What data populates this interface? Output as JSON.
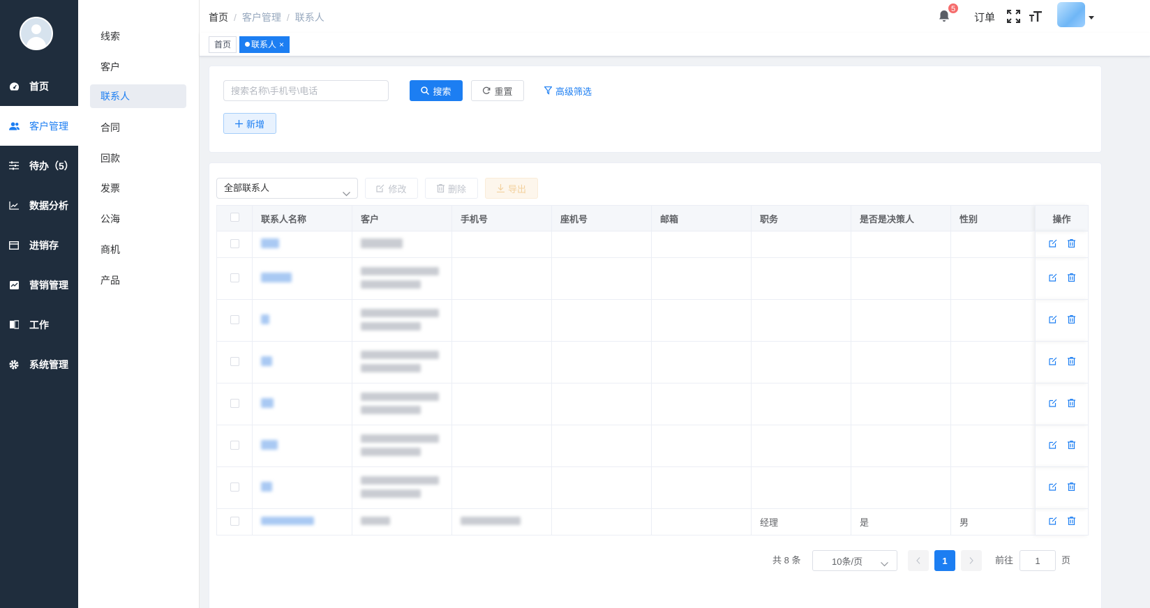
{
  "sidebar": {
    "items": [
      {
        "label": "首页",
        "icon": "dashboard-icon"
      },
      {
        "label": "客户管理",
        "icon": "user-icon",
        "active": true
      },
      {
        "label": "待办（5）",
        "icon": "sliders-icon"
      },
      {
        "label": "数据分析",
        "icon": "line-chart-icon"
      },
      {
        "label": "进销存",
        "icon": "folder-icon"
      },
      {
        "label": "营销管理",
        "icon": "marketing-icon"
      },
      {
        "label": "工作",
        "icon": "book-icon"
      },
      {
        "label": "系统管理",
        "icon": "gear-icon"
      }
    ]
  },
  "submenu": {
    "items": [
      "线索",
      "客户",
      "联系人",
      "合同",
      "回款",
      "发票",
      "公海",
      "商机",
      "产品"
    ],
    "active_index": 2
  },
  "header": {
    "breadcrumb": [
      "首页",
      "客户管理",
      "联系人"
    ],
    "notification_count": "5",
    "order_label": "订单"
  },
  "tags": {
    "home": "首页",
    "current": "联系人",
    "close_glyph": "×"
  },
  "search": {
    "placeholder": "搜索名称\\手机号\\电话",
    "search_label": "搜索",
    "reset_label": "重置",
    "advanced_label": "高级筛选",
    "add_label": "新增"
  },
  "toolbar": {
    "filter_selected": "全部联系人",
    "edit_label": "修改",
    "delete_label": "删除",
    "export_label": "导出"
  },
  "table": {
    "columns": [
      "联系人名称",
      "客户",
      "手机号",
      "座机号",
      "邮箱",
      "职务",
      "是否是决策人",
      "性别",
      "操作"
    ],
    "last_row": {
      "position": "经理",
      "decision_maker": "是",
      "gender": "男"
    }
  },
  "pagination": {
    "total": "共 8 条",
    "page_size": "10条/页",
    "current_page": "1",
    "goto_label": "前往",
    "goto_value": "1",
    "page_suffix": "页"
  },
  "colors": {
    "accent": "#1c7ef2",
    "sidebar": "#1f2d3d",
    "badge": "#f56c6c"
  }
}
